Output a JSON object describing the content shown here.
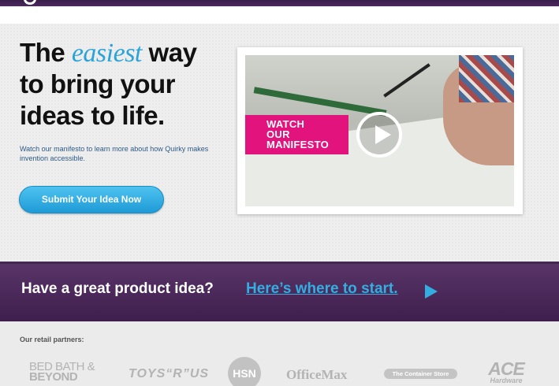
{
  "hero": {
    "headline_pre": "The ",
    "headline_accent": "easiest",
    "headline_post": " way",
    "headline_line2": "to bring your",
    "headline_line3": "ideas to life.",
    "subtext": "Watch our manifesto to learn more about how Quirky makes invention accessible.",
    "submit_label": "Submit Your Idea Now"
  },
  "video": {
    "label_line1": "WATCH",
    "label_line2": "OUR",
    "label_line3": "MANIFESTO",
    "play_icon": "play-icon"
  },
  "banner": {
    "question": "Have a great product idea?",
    "link": "Here’s where to start.",
    "arrow_icon": "arrow-right-icon"
  },
  "partners": {
    "title": "Our retail partners:",
    "bbb_line1": "BED BATH &",
    "bbb_line2": "BEYOND",
    "toys": "TOYS“R”US",
    "hsn": "HSN",
    "officemax": "OfficeMax",
    "container_store": "The Container Store",
    "ace": "ACE",
    "ace_sub": "Hardware"
  },
  "colors": {
    "brand_purple": "#4b2a5e",
    "accent_blue": "#2aa3d8",
    "magenta": "#e2137d"
  }
}
